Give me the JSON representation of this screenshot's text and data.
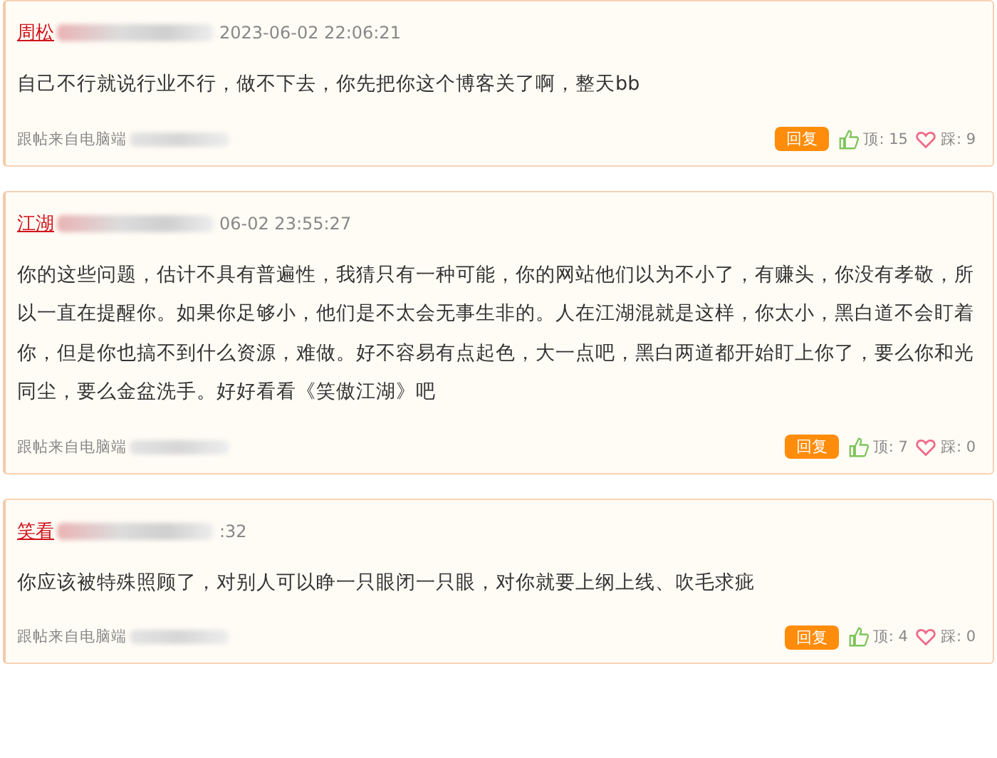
{
  "comments": [
    {
      "user": "周松",
      "time": "2023-06-02 22:06:21",
      "content": "自己不行就说行业不行，做不下去，你先把你这个博客关了啊，整天bb",
      "source": "跟帖来自电脑端",
      "reply": "回复",
      "up": "顶: 15",
      "down": "踩: 9"
    },
    {
      "user": "江湖",
      "time": "06-02 23:55:27",
      "content": "你的这些问题，估计不具有普遍性，我猜只有一种可能，你的网站他们以为不小了，有赚头，你没有孝敬，所以一直在提醒你。如果你足够小，他们是不太会无事生非的。人在江湖混就是这样，你太小，黑白道不会盯着你，但是你也搞不到什么资源，难做。好不容易有点起色，大一点吧，黑白两道都开始盯上你了，要么你和光同尘，要么金盆洗手。好好看看《笑傲江湖》吧",
      "source": "跟帖来自电脑端",
      "reply": "回复",
      "up": "顶: 7",
      "down": "踩: 0"
    },
    {
      "user": "笑看",
      "time": ":32",
      "content": "你应该被特殊照顾了，对别人可以睁一只眼闭一只眼，对你就要上纲上线、吹毛求疵",
      "source": "跟帖来自电脑端",
      "reply": "回复",
      "up": "顶: 4",
      "down": "踩: 0"
    }
  ]
}
